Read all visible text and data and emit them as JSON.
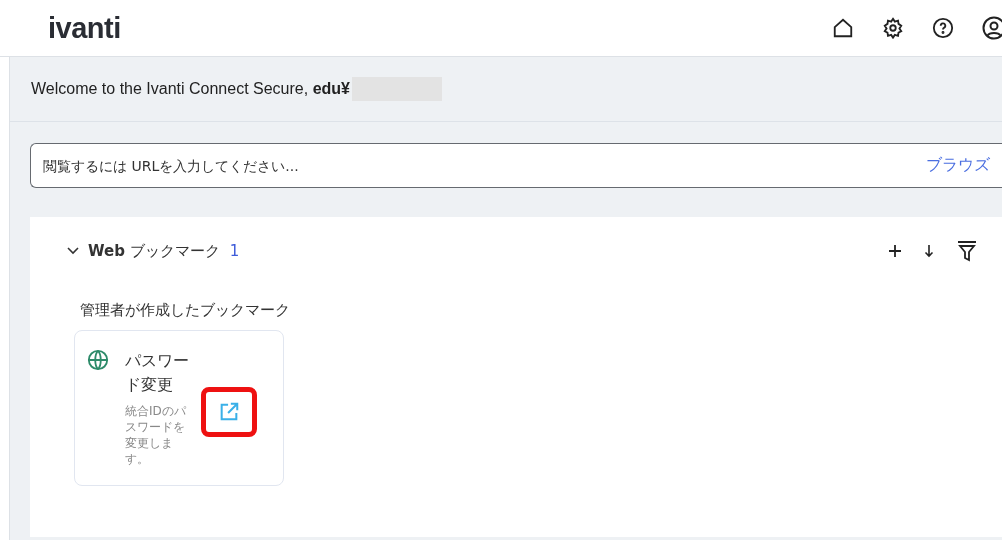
{
  "header": {
    "logo": "ivanti"
  },
  "welcome": {
    "text": "Welcome to the Ivanti Connect Secure, **edu¥**",
    "redacted": true
  },
  "url_field": {
    "placeholder": "閲覧するには URLを入力してください...",
    "browse": "ブラウズ"
  },
  "section": {
    "title": "**Web** ブックマーク",
    "count": "1",
    "expanded": true,
    "group_title": "管理者が作成したブックマーク",
    "bookmarks": [
      {
        "title": "パスワード変更",
        "description": "統合IDのパスワードを変更します。",
        "highlighted": true
      }
    ]
  }
}
